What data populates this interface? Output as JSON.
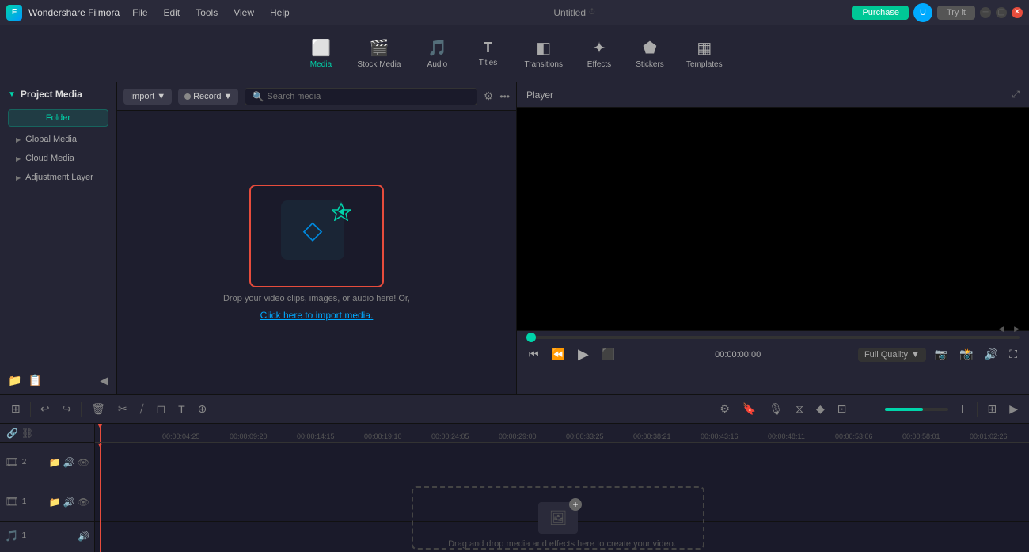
{
  "app": {
    "name": "Wondershare Filmora",
    "title": "Untitled",
    "logo_char": "F"
  },
  "menu": {
    "items": [
      "File",
      "Edit",
      "Tools",
      "View",
      "Help"
    ]
  },
  "title_bar": {
    "purchase_label": "Purchase",
    "try_label": "Try it"
  },
  "toolbar": {
    "tools": [
      {
        "id": "media",
        "icon": "⬜",
        "label": "Media",
        "active": true
      },
      {
        "id": "stock_media",
        "icon": "🎬",
        "label": "Stock Media"
      },
      {
        "id": "audio",
        "icon": "🎵",
        "label": "Audio"
      },
      {
        "id": "titles",
        "icon": "T",
        "label": "Titles"
      },
      {
        "id": "transitions",
        "icon": "◧",
        "label": "Transitions"
      },
      {
        "id": "effects",
        "icon": "✦",
        "label": "Effects"
      },
      {
        "id": "stickers",
        "icon": "⬟",
        "label": "Stickers"
      },
      {
        "id": "templates",
        "icon": "▦",
        "label": "Templates"
      }
    ]
  },
  "left_panel": {
    "title": "Project Media",
    "folder_btn": "Folder",
    "items": [
      {
        "label": "Global Media"
      },
      {
        "label": "Cloud Media"
      },
      {
        "label": "Adjustment Layer"
      }
    ]
  },
  "media_toolbar": {
    "import_label": "Import",
    "record_label": "Record",
    "search_placeholder": "Search media"
  },
  "media_drop": {
    "text": "Drop your video clips, images, or audio here! Or,",
    "link_text": "Click here to import media."
  },
  "player": {
    "title": "Player",
    "time": "00:00:00:00",
    "quality": "Full Quality"
  },
  "timeline": {
    "ticks": [
      "00:00:04:25",
      "00:00:09:20",
      "00:00:14:15",
      "00:00:19:10",
      "00:00:24:05",
      "00:00:29:00",
      "00:00:33:25",
      "00:00:38:21",
      "00:00:43:16",
      "00:00:48:11",
      "00:00:53:06",
      "00:00:58:01",
      "00:01:02:26"
    ],
    "drop_text": "Drag and drop media and effects here to create your video.",
    "tracks": [
      {
        "type": "video",
        "num": "2"
      },
      {
        "type": "video",
        "num": "1"
      },
      {
        "type": "audio",
        "num": "1"
      }
    ]
  }
}
